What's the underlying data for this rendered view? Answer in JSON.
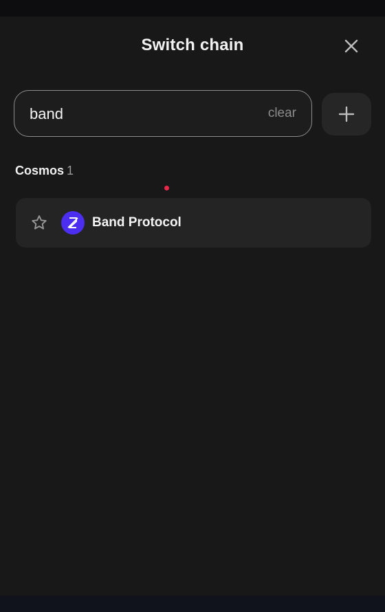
{
  "header": {
    "title": "Switch chain",
    "close_icon": "close-icon"
  },
  "search": {
    "value": "band",
    "clear_label": "clear",
    "add_icon": "plus-icon"
  },
  "sections": [
    {
      "label": "Cosmos",
      "count": "1",
      "items": [
        {
          "name": "Band Protocol",
          "favorite_icon": "star-outline-icon",
          "logo_icon": "band-protocol-logo",
          "logo_color": "#4b2ef0"
        }
      ]
    }
  ],
  "colors": {
    "background": "#181818",
    "row_background": "#242424",
    "accent_dot": "#e8294a"
  }
}
